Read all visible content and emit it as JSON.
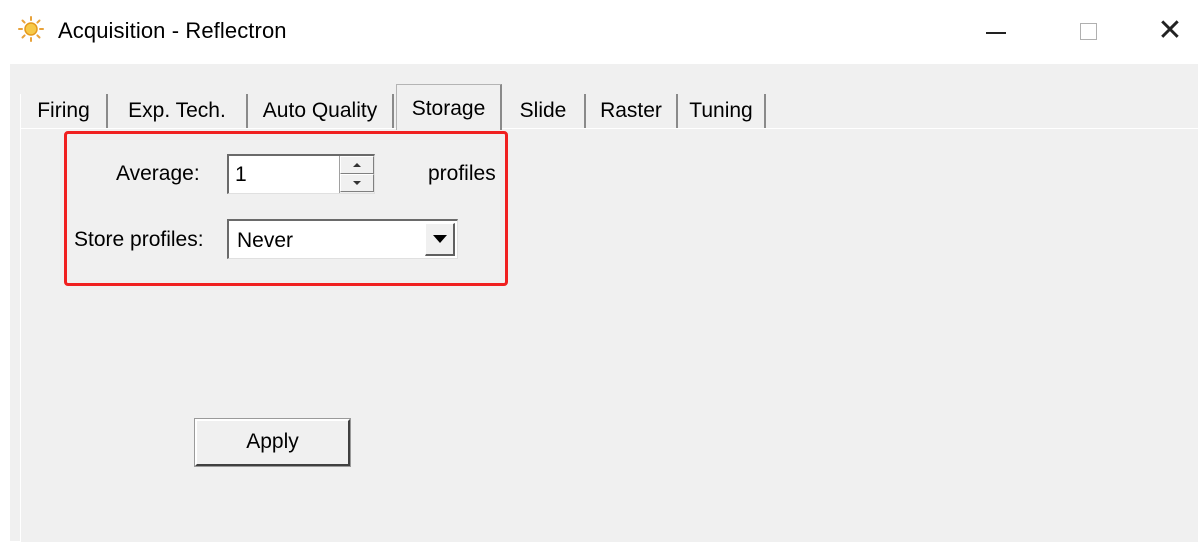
{
  "window": {
    "title": "Acquisition - Reflectron",
    "icon": "sun-icon",
    "controls": [
      "minimize-icon",
      "maximize-icon",
      "close-icon"
    ]
  },
  "tabs": [
    {
      "label": "Firing",
      "selected": false
    },
    {
      "label": "Exp. Tech.",
      "selected": false
    },
    {
      "label": "Auto Quality",
      "selected": false
    },
    {
      "label": "Storage",
      "selected": true
    },
    {
      "label": "Slide",
      "selected": false
    },
    {
      "label": "Raster",
      "selected": false
    },
    {
      "label": "Tuning",
      "selected": false
    }
  ],
  "storage": {
    "average_label": "Average:",
    "average_value": "1",
    "average_unit": "profiles",
    "store_label": "Store profiles:",
    "store_value": "Never"
  },
  "apply_label": "Apply",
  "colors": {
    "highlight": "#f02020",
    "dialog_bg": "#f0f0f0"
  }
}
